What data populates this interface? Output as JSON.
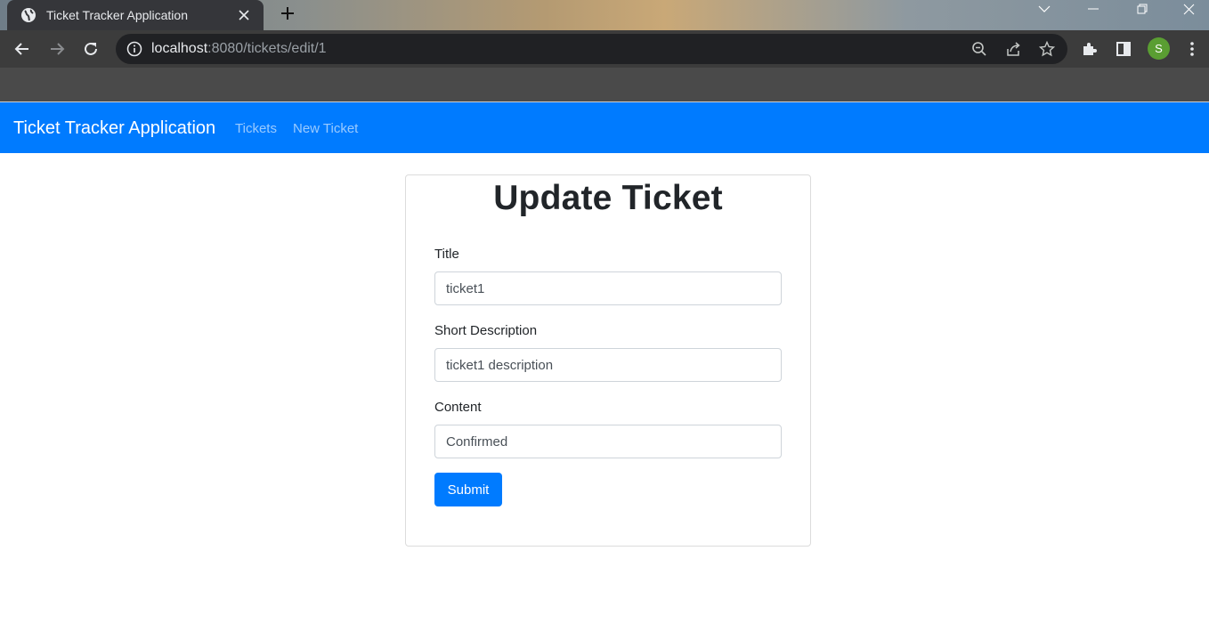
{
  "browser": {
    "tab_title": "Ticket Tracker Application",
    "url_host": "localhost",
    "url_rest": ":8080/tickets/edit/1",
    "profile_initial": "S",
    "icons": [
      "globe-icon",
      "close-icon",
      "plus-icon",
      "chevron-down-icon",
      "minimize-icon",
      "restore-icon",
      "close-window-icon",
      "back-icon",
      "forward-icon",
      "reload-icon",
      "info-icon",
      "zoom-out-icon",
      "share-icon",
      "star-icon",
      "extensions-icon",
      "side-panel-icon",
      "menu-icon"
    ]
  },
  "navbar": {
    "brand": "Ticket Tracker Application",
    "links": [
      "Tickets",
      "New Ticket"
    ],
    "color": "#007bff"
  },
  "form": {
    "heading": "Update Ticket",
    "title_label": "Title",
    "title_value": "ticket1",
    "short_description_label": "Short Description",
    "short_description_value": "ticket1 description",
    "content_label": "Content",
    "content_value": "Confirmed",
    "submit_label": "Submit"
  }
}
